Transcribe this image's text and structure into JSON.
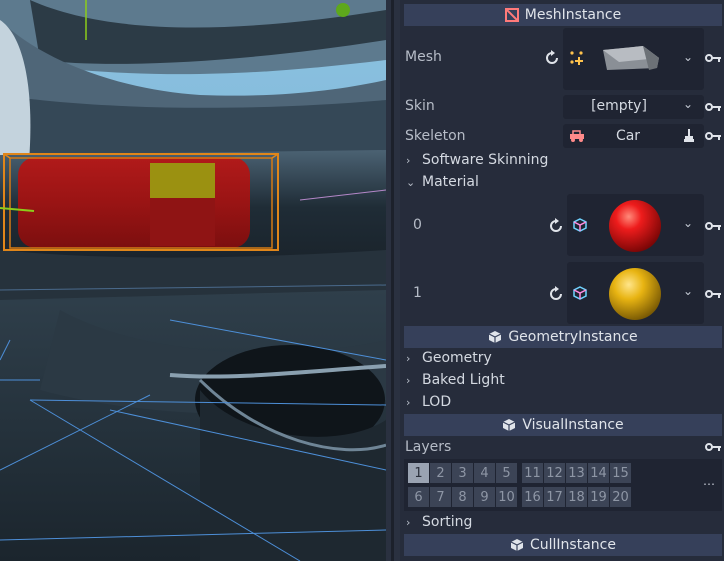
{
  "inspector": {
    "mesh_instance": {
      "title": "MeshInstance",
      "mesh_label": "Mesh",
      "skin_label": "Skin",
      "skin_value": "[empty]",
      "skeleton_label": "Skeleton",
      "skeleton_value": "Car",
      "software_skinning_label": "Software Skinning",
      "material_label": "Material",
      "materials": [
        {
          "index": "0",
          "color": "#e01818"
        },
        {
          "index": "1",
          "color": "#e8b412"
        }
      ]
    },
    "geometry_instance": {
      "title": "GeometryInstance",
      "categories": [
        "Geometry",
        "Baked Light",
        "LOD"
      ]
    },
    "visual_instance": {
      "title": "VisualInstance",
      "layers_label": "Layers",
      "layers_row1": [
        "1",
        "2",
        "3",
        "4",
        "5",
        "11",
        "12",
        "13",
        "14",
        "15"
      ],
      "layers_row2": [
        "6",
        "7",
        "8",
        "9",
        "10",
        "16",
        "17",
        "18",
        "19",
        "20"
      ],
      "active_layers": [
        "1"
      ],
      "sorting_label": "Sorting"
    },
    "cull_instance": {
      "title": "CullInstance"
    }
  },
  "icons": {
    "revert": "revert-icon",
    "key": "key-icon",
    "chevron": "chevron-down-icon",
    "mesh_node": "mesh-instance-icon",
    "cube": "cube-icon"
  }
}
